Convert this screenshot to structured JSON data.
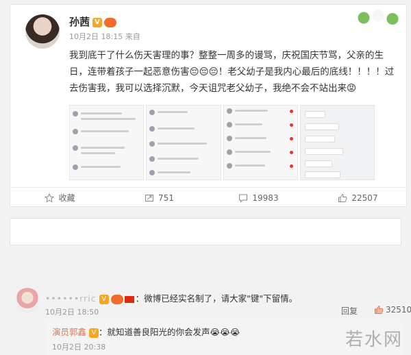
{
  "post": {
    "author": "孙茜",
    "meta": "10月2日 18:15 来自",
    "text": "我到底干了什么伤天害理的事？整整一周多的谩骂，庆祝国庆节骂，父亲的生日，连带着孩子一起恶意伤害😔😔😔！老父幼子是我内心最后的底线！！！！过去伤害我，我可以选择沉默，今天诅咒老父幼子，我绝不会不站出来😡",
    "actions": {
      "favorite": "收藏",
      "forward": "751",
      "comment": "19983",
      "like": "22507"
    }
  },
  "comment": {
    "user": "••••••rric",
    "text": "：微博已经实名制了，请大家\"键\"下留情。",
    "meta": "10月2日 18:50",
    "reply_label": "回复",
    "likes": "32510",
    "sub": {
      "user": "演员郭鑫",
      "text": "：就知道善良阳光的你会发声😭😭😭",
      "meta": "10月2日 20:38"
    }
  },
  "watermark": "若水网",
  "colors": {
    "accent": "#eb7350",
    "badge_v": "#f6a623",
    "red": "#e5342f"
  }
}
